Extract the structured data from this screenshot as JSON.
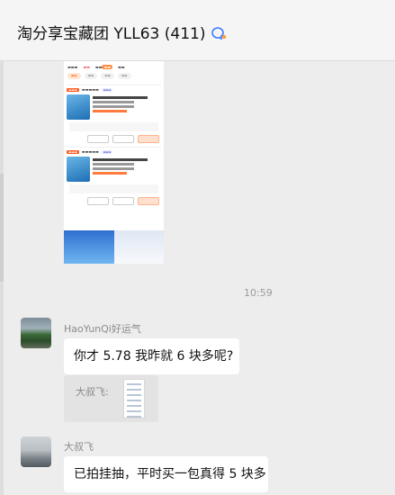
{
  "header": {
    "title": "淘分享宝藏团 YLL63 (411)",
    "icon": "chat-bubble-icon"
  },
  "messages": [
    {
      "type": "image",
      "description_icon": "shared-screenshot"
    },
    {
      "type": "timestamp",
      "text": "10:59"
    },
    {
      "type": "text",
      "sender": "HaoYunQi好运气",
      "text": "你才 5.78 我昨就 6 块多呢?"
    },
    {
      "type": "quote",
      "quoted_sender": "大叔飞:"
    },
    {
      "type": "text",
      "sender": "大叔飞",
      "text": "已拍挂抽，平时买一包真得 5 块多"
    }
  ],
  "colors": {
    "background": "#ededed",
    "bubble": "#ffffff",
    "accent": "#3b7cff"
  }
}
